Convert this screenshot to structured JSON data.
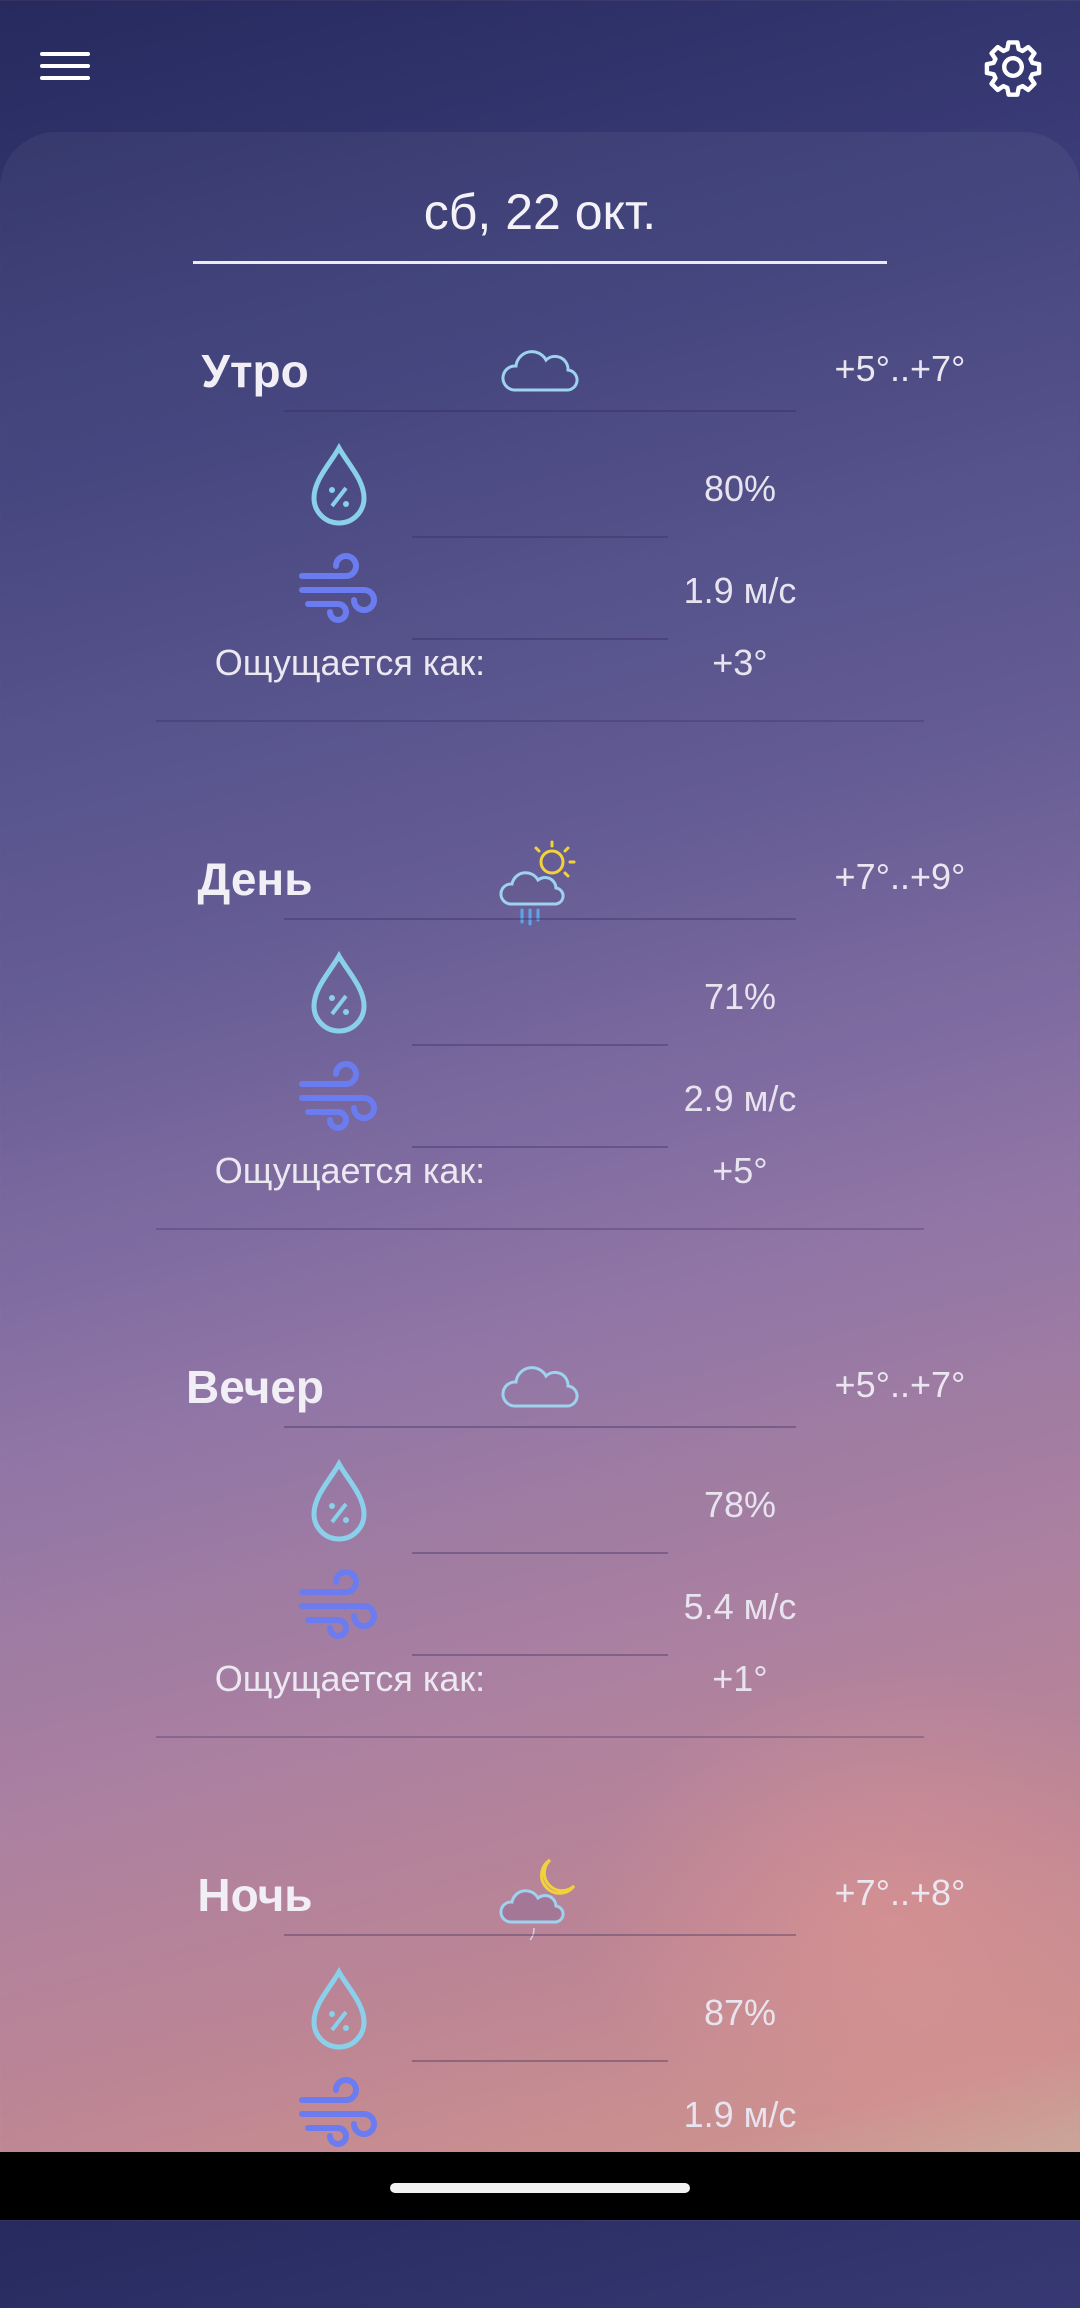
{
  "header": {
    "menu_icon": "hamburger-menu-icon",
    "settings_icon": "gear-icon"
  },
  "date": "сб, 22 окт.",
  "feels_like_label": "Ощущается как:",
  "colors": {
    "drop": "#8ad0ea",
    "wind": "#6a7cf0",
    "cloud": "#9ed2ee",
    "sun": "#f2d23a",
    "rain": "#5da6ee"
  },
  "periods": [
    {
      "name": "Утро",
      "icon": "cloud-icon",
      "temp": "+5°..+7°",
      "humidity": "80%",
      "wind": "1.9 м/с",
      "feels": "+3°"
    },
    {
      "name": "День",
      "icon": "partly-sunny-rain-icon",
      "temp": "+7°..+9°",
      "humidity": "71%",
      "wind": "2.9 м/с",
      "feels": "+5°"
    },
    {
      "name": "Вечер",
      "icon": "cloud-icon",
      "temp": "+5°..+7°",
      "humidity": "78%",
      "wind": "5.4 м/с",
      "feels": "+1°"
    },
    {
      "name": "Ночь",
      "icon": "cloud-moon-icon",
      "temp": "+7°..+8°",
      "humidity": "87%",
      "wind": "1.9 м/с"
    }
  ]
}
